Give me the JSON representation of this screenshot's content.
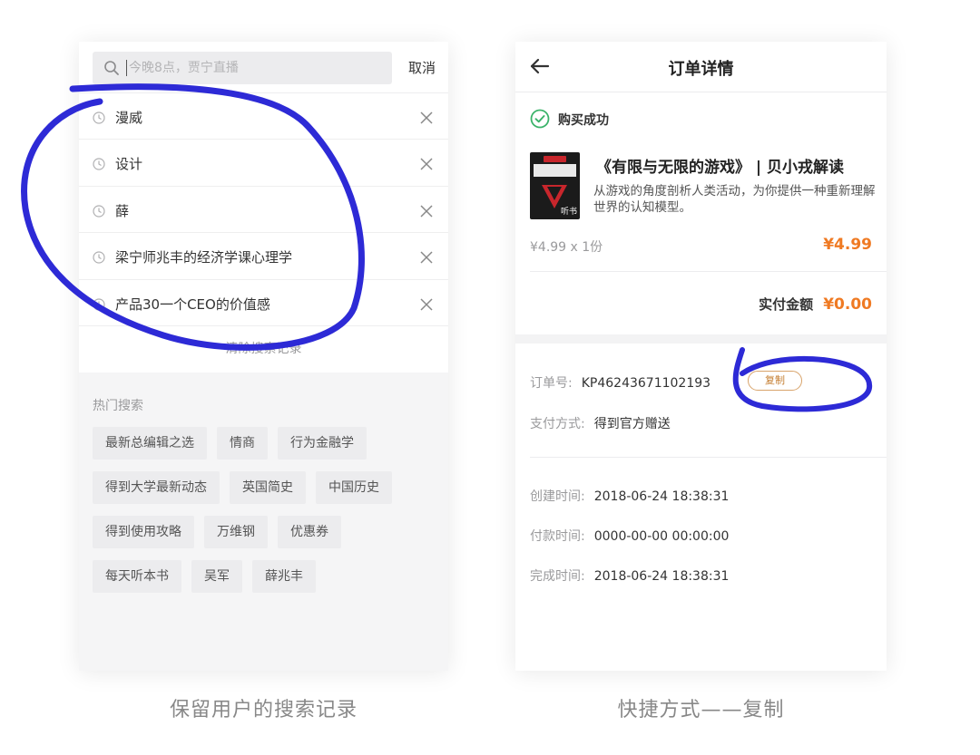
{
  "left": {
    "search": {
      "placeholder": "今晚8点，贾宁直播",
      "value": ""
    },
    "cancel_label": "取消",
    "history": [
      {
        "label": "漫威"
      },
      {
        "label": "设计"
      },
      {
        "label": "薛"
      },
      {
        "label": "梁宁师兆丰的经济学课心理学"
      },
      {
        "label": "产品30一个CEO的价值感"
      }
    ],
    "clear_history_label": "清除搜索记录",
    "hot_title": "热门搜索",
    "hot_tags": [
      [
        "最新总编辑之选",
        "情商",
        "行为金融学"
      ],
      [
        "得到大学最新动态",
        "英国简史",
        "中国历史"
      ],
      [
        "得到使用攻略",
        "万维钢",
        "优惠券"
      ],
      [
        "每天听本书",
        "吴军",
        "薛兆丰"
      ]
    ],
    "caption": "保留用户的搜索记录"
  },
  "right": {
    "nav_title": "订单详情",
    "status_text": "购买成功",
    "book": {
      "title": "《有限与无限的游戏》 | 贝小戎解读",
      "description": "从游戏的角度剖析人类活动，为你提供一种重新理解世界的认知模型。",
      "cover_label": "听书"
    },
    "unit_price_qty": "¥4.99 x 1份",
    "subtotal": "¥4.99",
    "paid_label": "实付金额",
    "paid_amount": "¥0.00",
    "order_no_label": "订单号:",
    "order_no": "KP46243671102193",
    "copy_label": "复制",
    "payment_method_label": "支付方式:",
    "payment_method": "得到官方赠送",
    "created_label": "创建时间:",
    "created_time": "2018-06-24 18:38:31",
    "paid_time_label": "付款时间:",
    "paid_time": "0000-00-00 00:00:00",
    "completed_label": "完成时间:",
    "completed_time": "2018-06-24 18:38:31",
    "caption": "快捷方式——复制"
  },
  "colors": {
    "accent_orange": "#ef7a23",
    "success_green": "#3bb36a",
    "annotation_blue": "#2d2ad6",
    "copy_border": "#d8a36a"
  }
}
